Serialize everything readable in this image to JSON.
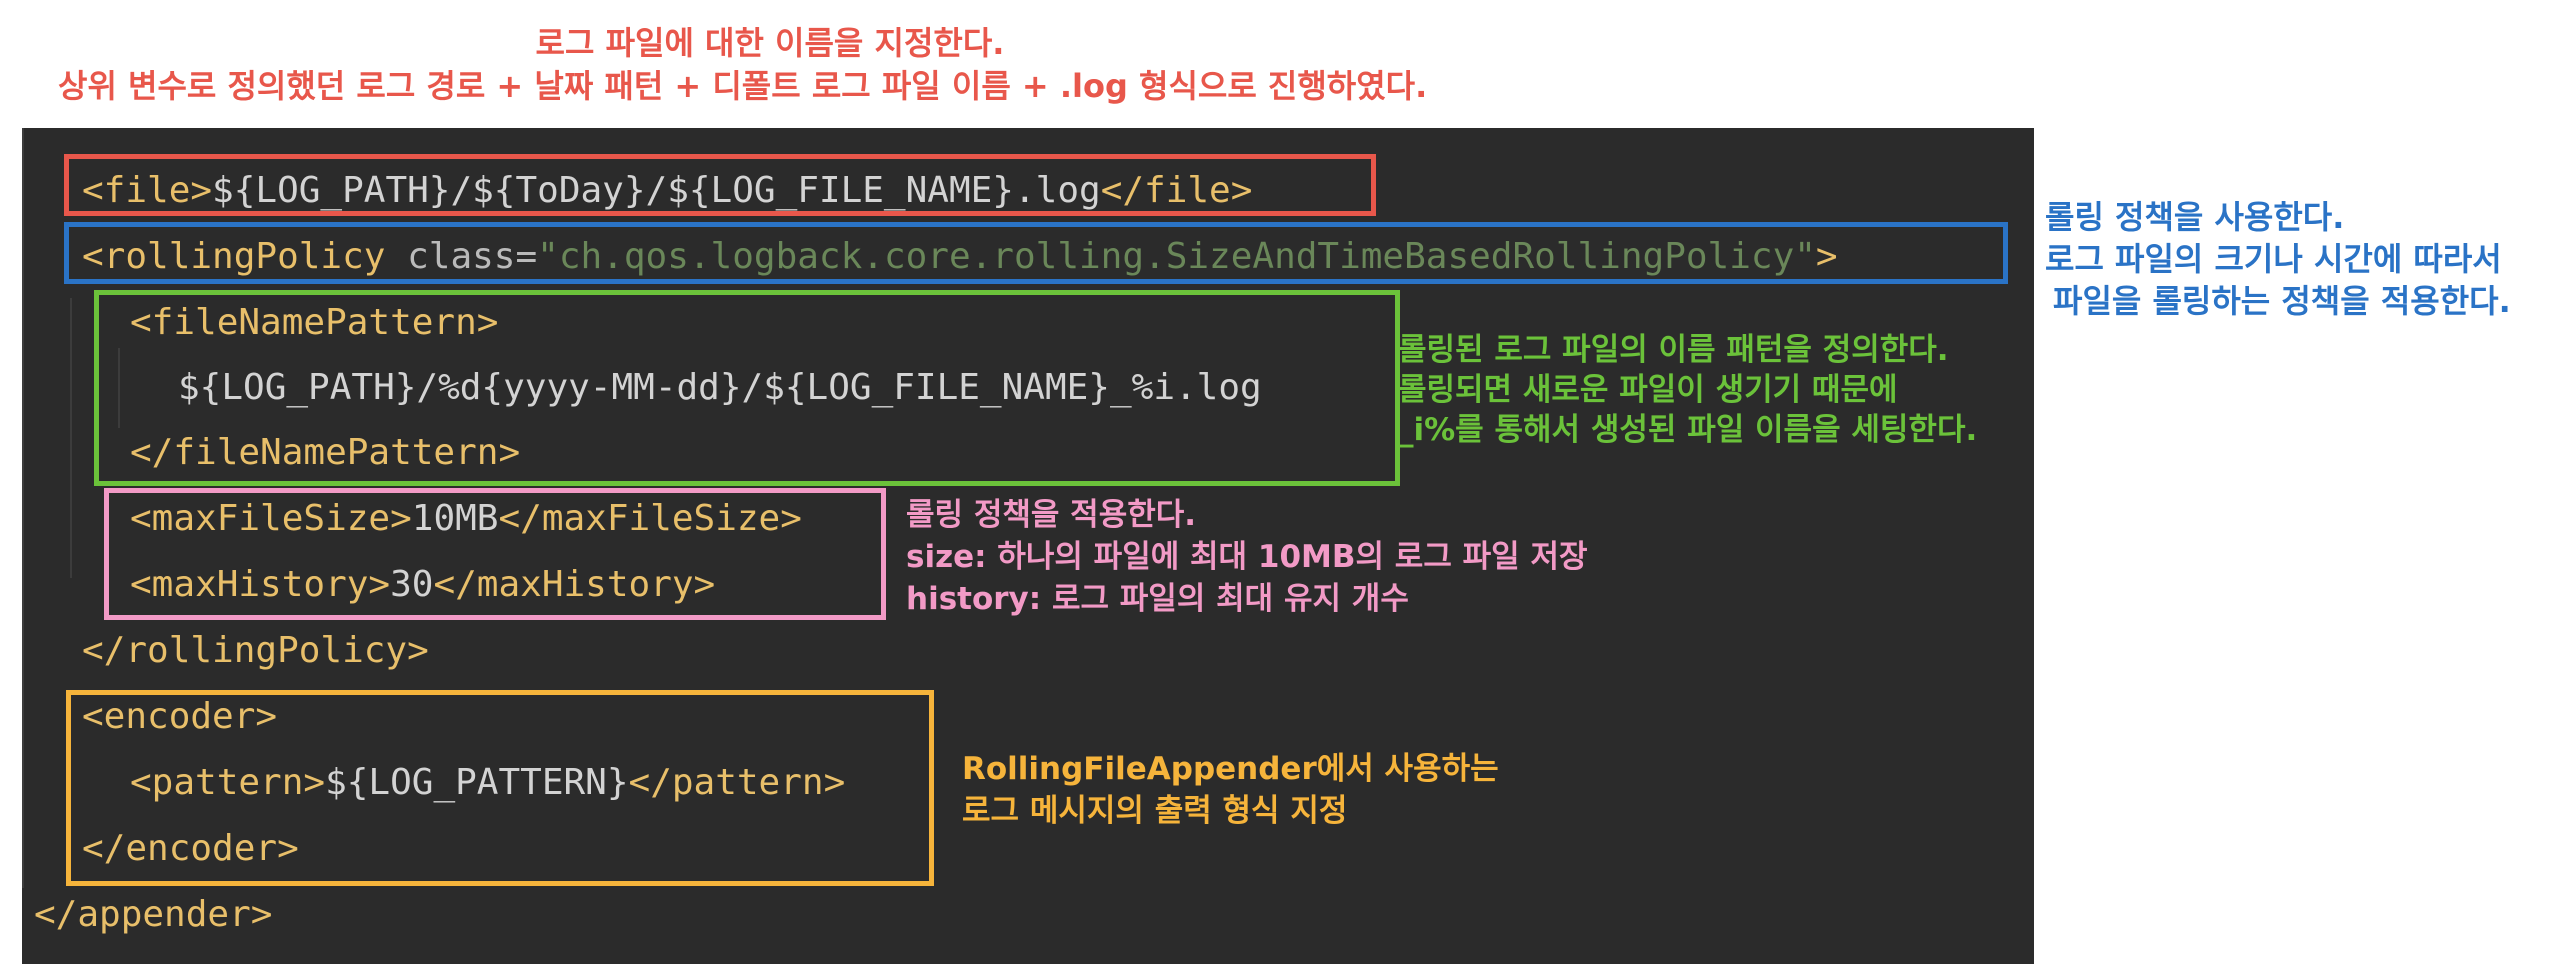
{
  "colors": {
    "red": "#e8574b",
    "blue": "#2a73c6",
    "green": "#6bc23a",
    "pink": "#f29ac6",
    "orange": "#f6b43b",
    "editor_bg": "#2b2b2b",
    "tag": "#e8bf6a",
    "string": "#6a8759"
  },
  "annotations": {
    "file_name": {
      "line1": "로그 파일에 대한 이름을 지정한다.",
      "line2": "상위 변수로 정의했던 로그 경로 + 날짜 패턴 + 디폴트 로그 파일 이름 + .log 형식으로 진행하였다."
    },
    "rolling_policy": {
      "line1": "롤링 정책을 사용한다.",
      "line2": "로그 파일의 크기나 시간에 따라서",
      "line3": "파일을 롤링하는 정책을 적용한다."
    },
    "file_name_pattern": {
      "line1": "롤링된 로그 파일의 이름 패턴을 정의한다.",
      "line2": "롤링되면 새로운 파일이 생기기 때문에",
      "line3": "_i%를 통해서 생성된 파일 이름을 세팅한다."
    },
    "size_history": {
      "line1": "롤링 정책을 적용한다.",
      "line2": "size: 하나의 파일에 최대 10MB의 로그 파일 저장",
      "line3": "history: 로그 파일의 최대 유지 개수"
    },
    "encoder": {
      "line1": "RollingFileAppender에서 사용하는",
      "line2": "로그 메시지의 출력 형식 지정"
    }
  },
  "code": {
    "file_open": "<file>",
    "file_value": "${LOG_PATH}/${ToDay}/${LOG_FILE_NAME}.log",
    "file_close": "</file>",
    "rolling_open": "<rollingPolicy ",
    "rolling_attr": "class=",
    "rolling_class": "\"ch.qos.logback.core.rolling.SizeAndTimeBasedRollingPolicy\"",
    "rolling_end": ">",
    "fnp_open": "<fileNamePattern>",
    "fnp_value": "${LOG_PATH}/%d{yyyy-MM-dd}/${LOG_FILE_NAME}_%i.log",
    "fnp_close": "</fileNamePattern>",
    "maxsize_open": "<maxFileSize>",
    "maxsize_value": "10MB",
    "maxsize_close": "</maxFileSize>",
    "maxhist_open": "<maxHistory>",
    "maxhist_value": "30",
    "maxhist_close": "</maxHistory>",
    "rolling_close": "</rollingPolicy>",
    "encoder_open": "<encoder>",
    "pattern_open": "<pattern>",
    "pattern_value": "${LOG_PATTERN}",
    "pattern_close": "</pattern>",
    "encoder_close": "</encoder>",
    "appender_close": "</appender>"
  }
}
